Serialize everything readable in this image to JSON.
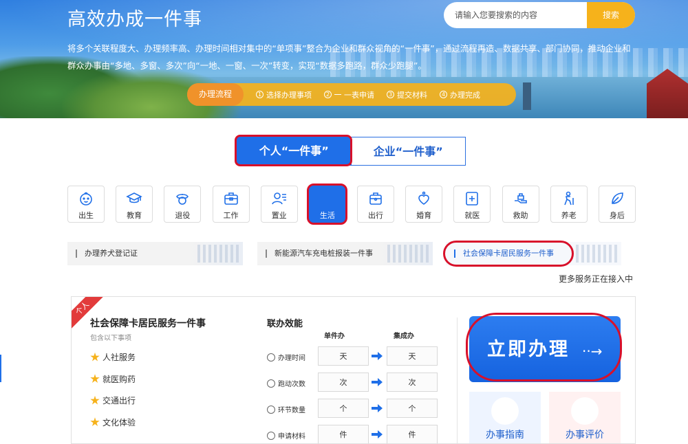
{
  "banner": {
    "title": "高效办成一件事",
    "search_placeholder": "请输入您要搜索的内容",
    "search_button": "搜索",
    "description": "将多个关联程度大、办理频率高、办理时间相对集中的“单项事”整合为企业和群众视角的“一件事”，通过流程再造、数据共享、部门协同，推动企业和群众办事由“多地、多窗、多次”向“一地、一窗、一次”转变，实现“数据多跑路，群众少跑腿”。",
    "process_label": "办理流程",
    "steps": [
      {
        "num": "1",
        "label": "选择办理事项"
      },
      {
        "num": "2",
        "label": "一表申请"
      },
      {
        "num": "3",
        "label": "提交材料"
      },
      {
        "num": "4",
        "label": "办理完成"
      }
    ]
  },
  "tabs": [
    "个人“一件事”",
    "企业“一件事”"
  ],
  "categories": [
    {
      "label": "出生",
      "icon": "baby-face-icon"
    },
    {
      "label": "教育",
      "icon": "graduation-cap-icon"
    },
    {
      "label": "退役",
      "icon": "soldier-cap-icon"
    },
    {
      "label": "工作",
      "icon": "briefcase-icon"
    },
    {
      "label": "置业",
      "icon": "person-list-icon"
    },
    {
      "label": "生活",
      "icon": "life-icon"
    },
    {
      "label": "出行",
      "icon": "suitcase-icon"
    },
    {
      "label": "婚育",
      "icon": "heart-person-icon"
    },
    {
      "label": "就医",
      "icon": "medical-cross-icon"
    },
    {
      "label": "救助",
      "icon": "helping-hand-icon"
    },
    {
      "label": "养老",
      "icon": "elder-icon"
    },
    {
      "label": "身后",
      "icon": "leaf-icon"
    }
  ],
  "active_category": "生活",
  "services": [
    "办理养犬登记证",
    "新能源汽车充电桩报装一件事",
    "社会保障卡居民服务一件事"
  ],
  "more_text": "更多服务正在接入中",
  "card": {
    "ribbon": "个人",
    "title": "社会保障卡居民服务一件事",
    "subtitle": "包含以下事项",
    "items": [
      "人社服务",
      "就医购药",
      "交通出行",
      "文化体验"
    ],
    "efficiency_title": "联办效能",
    "col_single": "单件办",
    "col_integrated": "集成办",
    "rows": [
      {
        "label": "办理时间",
        "single": "天",
        "integrated": "天"
      },
      {
        "label": "跑动次数",
        "single": "次",
        "integrated": "次"
      },
      {
        "label": "环节数量",
        "single": "个",
        "integrated": "个"
      },
      {
        "label": "申请材料",
        "single": "件",
        "integrated": "件"
      }
    ],
    "do_button": "立即办理",
    "do_arrow": "··→",
    "guide_button": "办事指南",
    "rate_button": "办事评价"
  },
  "colors": {
    "primary": "#1f6fe8",
    "accent": "#f6b21b",
    "highlight": "#d8102a"
  }
}
